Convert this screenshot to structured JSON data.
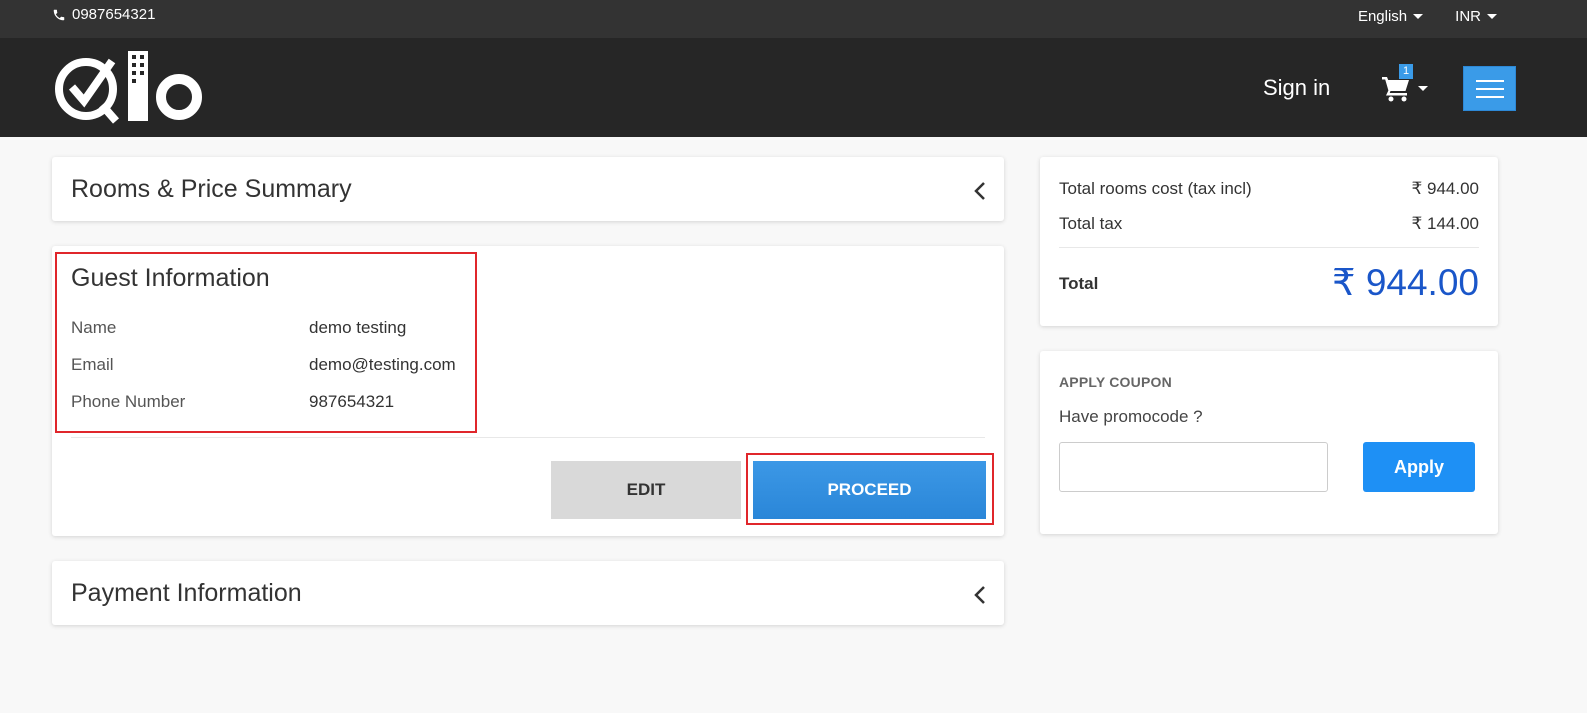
{
  "topbar": {
    "phone": "0987654321",
    "language": "English",
    "currency": "INR"
  },
  "header": {
    "sign_in": "Sign in",
    "cart_count": "1"
  },
  "rooms_summary": {
    "title": "Rooms & Price Summary"
  },
  "guest": {
    "title": "Guest Information",
    "rows": [
      {
        "label": "Name",
        "value": "demo testing"
      },
      {
        "label": "Email",
        "value": "demo@testing.com"
      },
      {
        "label": "Phone Number",
        "value": "987654321"
      }
    ],
    "edit_label": "EDIT",
    "proceed_label": "PROCEED"
  },
  "payment": {
    "title": "Payment Information"
  },
  "summary": {
    "rooms_cost_label": "Total rooms cost (tax incl)",
    "rooms_cost_value": "₹ 944.00",
    "tax_label": "Total tax",
    "tax_value": "₹ 144.00",
    "total_label": "Total",
    "total_value": "₹ 944.00"
  },
  "coupon": {
    "heading": "APPLY COUPON",
    "subtitle": "Have promocode ?",
    "input_value": "",
    "apply_label": "Apply"
  },
  "colors": {
    "accent": "#3a9be8",
    "highlight_border": "#e0262b",
    "total_price": "#1a56c9"
  }
}
